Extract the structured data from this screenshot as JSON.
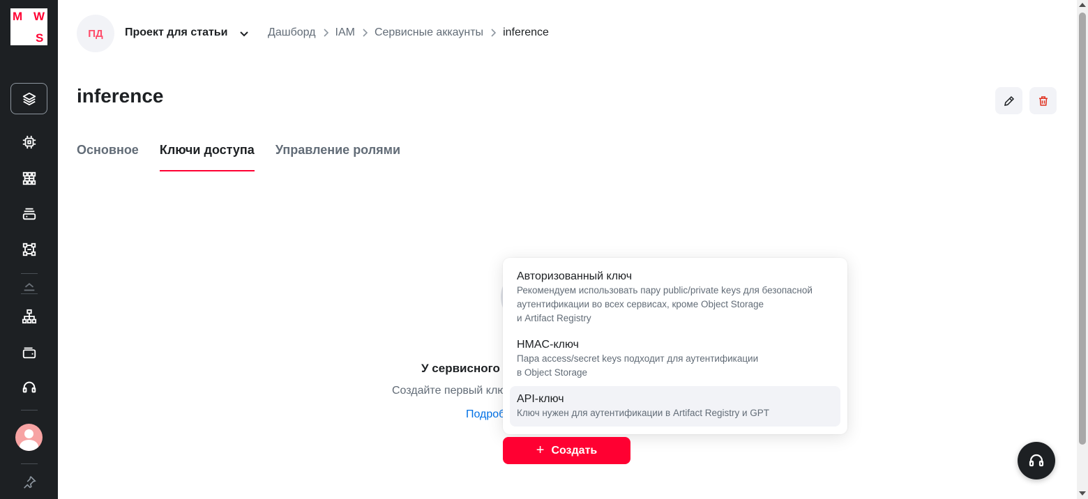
{
  "brand": {
    "logo_letters": [
      "M",
      "W",
      "S"
    ],
    "accent": "#ff0032",
    "sidebar_bg": "#1d2023"
  },
  "sidebar": {
    "items": [
      {
        "icon": "layers-icon",
        "active": true
      },
      {
        "icon": "chip-icon"
      },
      {
        "icon": "hierarchy-grid-icon"
      },
      {
        "icon": "storage-icon"
      },
      {
        "icon": "network-nodes-icon"
      },
      {
        "icon": "collapse-up-icon"
      },
      {
        "icon": "org-structure-icon"
      },
      {
        "icon": "wallet-icon"
      },
      {
        "icon": "headset-icon"
      },
      {
        "icon": "avatar"
      },
      {
        "icon": "pin-icon"
      }
    ]
  },
  "header": {
    "project_initials": "ПД",
    "project_name": "Проект для статьи",
    "breadcrumb": [
      "Дашборд",
      "IAM",
      "Сервисные аккаунты",
      "inference"
    ]
  },
  "page": {
    "title": "inference",
    "tabs": [
      {
        "label": "Основное",
        "active": false
      },
      {
        "label": "Ключи доступа",
        "active": true
      },
      {
        "label": "Управление ролями",
        "active": false
      }
    ]
  },
  "empty_state": {
    "title_visible": "У сервисного",
    "desc_visible": "Создайте первый клю",
    "link_visible": "Подроб"
  },
  "create_button": {
    "label": "Создать"
  },
  "dropdown": {
    "items": [
      {
        "title": "Авторизованный ключ",
        "desc_lines": [
          "Рекомендуем использовать пару public/private keys для безопасной",
          "аутентификации во всех сервисах, кроме Object Storage",
          "и Artifact Registry"
        ]
      },
      {
        "title": "HMAC-ключ",
        "desc_lines": [
          "Пара access/secret keys подходит для аутентификации",
          "в Object Storage"
        ]
      },
      {
        "title": "API-ключ",
        "desc_lines": [
          "Ключ нужен для аутентификации в Artifact Registry и GPT"
        ],
        "hovered": true
      }
    ]
  }
}
